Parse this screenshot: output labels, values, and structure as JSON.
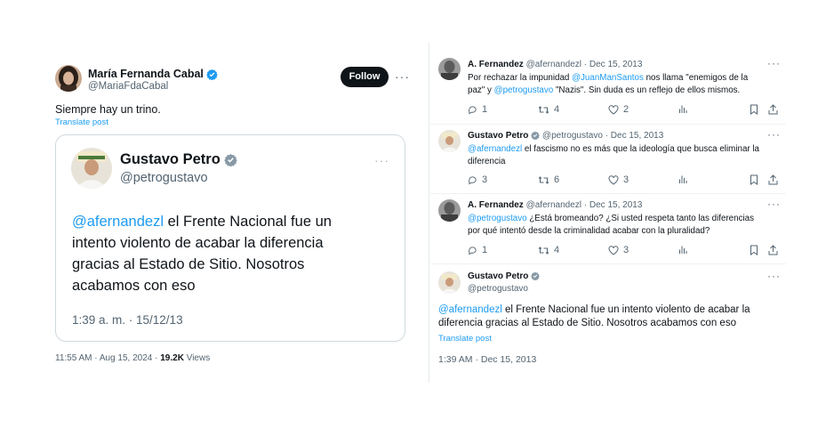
{
  "left": {
    "author_name": "María Fernanda Cabal",
    "author_handle": "@MariaFdaCabal",
    "follow_label": "Follow",
    "text": "Siempre hay un trino.",
    "translate": "Translate post",
    "quoted": {
      "author_name": "Gustavo Petro",
      "author_handle": "@petrogustavo",
      "mention": "@afernandezl",
      "text_line1": " el Frente Nacional fue un",
      "text_line2": "intento violento de acabar la diferencia",
      "text_line3": "gracias al Estado de Sitio. Nosotros",
      "text_line4": "acabamos con eso",
      "timestamp": "1:39 a. m. · 15/12/13"
    },
    "meta_time": "11:55 AM · Aug 15, 2024 · ",
    "meta_views_count": "19.2K",
    "meta_views_label": " Views"
  },
  "right": {
    "tweets": [
      {
        "name": "A. Fernandez",
        "handle": "@afernandezl",
        "date": "· Dec 15, 2013",
        "line1_a": "Por rechazar la impunidad ",
        "line1_mention": "@JuanManSantos",
        "line1_b": " nos llama \"enemigos de la",
        "line2_a": "paz\" y ",
        "line2_mention": "@petrogustavo",
        "line2_b": " \"Nazis\". Sin duda es un reflejo de ellos mismos.",
        "replies": "1",
        "retweets": "4",
        "likes": "2"
      },
      {
        "name": "Gustavo Petro",
        "handle": "@petrogustavo",
        "date": "· Dec 15, 2013",
        "line1_mention": "@afernandezl",
        "line1_b": " el fascismo no es más que la ideología que busca eliminar la",
        "line2_a": "diferencia",
        "replies": "3",
        "retweets": "6",
        "likes": "3"
      },
      {
        "name": "A. Fernandez",
        "handle": "@afernandezl",
        "date": "· Dec 15, 2013",
        "line1_mention": "@petrogustavo",
        "line1_b": " ¿Está bromeando? ¿Si usted respeta tanto las diferencias",
        "line2_a": "por qué intentó desde la criminalidad acabar con la pluralidad?",
        "replies": "1",
        "retweets": "4",
        "likes": "3"
      }
    ],
    "main": {
      "name": "Gustavo Petro",
      "handle": "@petrogustavo",
      "mention": "@afernandezl",
      "line1_b": " el Frente Nacional fue un intento violento de acabar la",
      "line2": "diferencia gracias al Estado de Sitio. Nosotros acabamos con eso",
      "translate": "Translate post",
      "meta": "1:39 AM · Dec 15, 2013"
    }
  },
  "colors": {
    "accent": "#1d9bf0",
    "muted": "#536471",
    "text": "#0f1419"
  },
  "icons": [
    "verified-badge-icon",
    "more-dots-icon",
    "reply-icon",
    "retweet-icon",
    "like-icon",
    "views-icon",
    "bookmark-icon",
    "share-icon"
  ]
}
